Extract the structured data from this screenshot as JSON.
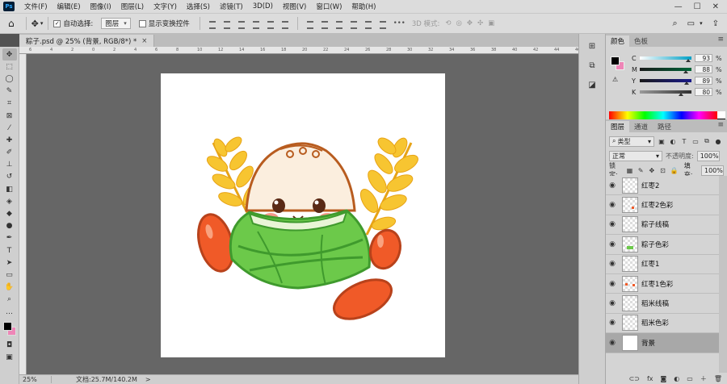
{
  "menubar": {
    "app_icon": "Ps",
    "items": [
      "文件(F)",
      "编辑(E)",
      "图像(I)",
      "图层(L)",
      "文字(Y)",
      "选择(S)",
      "滤镜(T)",
      "3D(D)",
      "视图(V)",
      "窗口(W)",
      "帮助(H)"
    ],
    "window_controls": [
      "—",
      "☐",
      "✕"
    ]
  },
  "options_bar": {
    "auto_select_label": "自动选择:",
    "auto_select_value": "图层",
    "show_transform_label": "显示变换控件",
    "mode3d_label": "3D 模式:"
  },
  "document_tab": {
    "title": "粽子.psd @ 25% (背景, RGB/8*) *",
    "close": "×"
  },
  "ruler_ticks": [
    "6",
    "4",
    "2",
    "0",
    "2",
    "4",
    "6",
    "8",
    "10",
    "12",
    "14",
    "16",
    "18",
    "20",
    "22",
    "24",
    "26",
    "28",
    "30",
    "32",
    "34",
    "36",
    "38",
    "40",
    "42",
    "44",
    "46"
  ],
  "status": {
    "zoom": "25%",
    "doc_info": "文档:25.7M/140.2M",
    "arrow": ">"
  },
  "color_panel": {
    "tabs": [
      "颜色",
      "色板"
    ],
    "foreground": "#000000",
    "background": "#ee86b7",
    "channels": [
      {
        "label": "C",
        "value": "93",
        "percent": 93,
        "color": "#00a0c6",
        "pct": "%"
      },
      {
        "label": "M",
        "value": "88",
        "percent": 88,
        "color": "#006437",
        "pct": "%"
      },
      {
        "label": "Y",
        "value": "89",
        "percent": 89,
        "color": "#1a1a8a",
        "pct": "%"
      },
      {
        "label": "K",
        "value": "80",
        "percent": 80,
        "color": "#303030",
        "pct": "%"
      }
    ]
  },
  "layers_panel": {
    "tabs": [
      "图层",
      "通道",
      "路径"
    ],
    "filter_value": "类型",
    "blend_mode": "正常",
    "opacity_label": "不透明度:",
    "opacity_value": "100%",
    "lock_label": "锁定:",
    "fill_label": "填充:",
    "fill_value": "100%",
    "layers": [
      {
        "name": "红枣2",
        "thumb": "checker"
      },
      {
        "name": "红枣2色彩",
        "thumb": "red"
      },
      {
        "name": "粽子线稿",
        "thumb": "checker"
      },
      {
        "name": "粽子色彩",
        "thumb": "green"
      },
      {
        "name": "红枣1",
        "thumb": "checker"
      },
      {
        "name": "红枣1色彩",
        "thumb": "red"
      },
      {
        "name": "稻米线稿",
        "thumb": "checker"
      },
      {
        "name": "稻米色彩",
        "thumb": "checker"
      },
      {
        "name": "背景",
        "thumb": "white"
      }
    ],
    "footer_icons": [
      "⊂⊃",
      "fx",
      "◙",
      "◐",
      "▭",
      "＋",
      "🗑"
    ]
  },
  "canvas": {
    "colors": {
      "rice_fill": "#fbeede",
      "rice_line": "#b85c1f",
      "leaf_green": "#6cc94a",
      "leaf_dark": "#3f9a2d",
      "wheat": "#f7c531",
      "wheat_line": "#e7a316",
      "date": "#f05a28",
      "date_line": "#b8421b",
      "blush": "#f5988a",
      "eye": "#5a2a16"
    }
  }
}
